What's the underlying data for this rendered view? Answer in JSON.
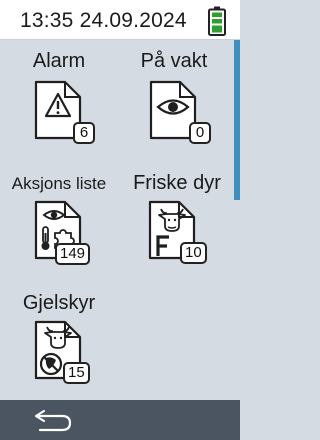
{
  "status": {
    "time": "13:35",
    "date": "24.09.2024",
    "battery_icon": "battery-full-icon",
    "battery_color": "#2e9e2e"
  },
  "tiles": [
    {
      "label": "Alarm",
      "count": "6",
      "icon": "warning-icon"
    },
    {
      "label": "På vakt",
      "count": "0",
      "icon": "eye-icon"
    },
    {
      "label": "Aksjons liste",
      "count": "149",
      "icon": "eye-thermometer-puzzle-icon"
    },
    {
      "label": "Friske dyr",
      "count": "10",
      "icon": "cow-head-f-icon"
    },
    {
      "label": "Gjelskyr",
      "count": "15",
      "icon": "cow-head-no-milk-icon"
    }
  ],
  "nav": {
    "back_icon": "back-arrow-icon"
  },
  "colors": {
    "background": "#d4dbe2",
    "bottom_bar": "#4b5461",
    "scroll_thumb": "#3f8fbe"
  }
}
